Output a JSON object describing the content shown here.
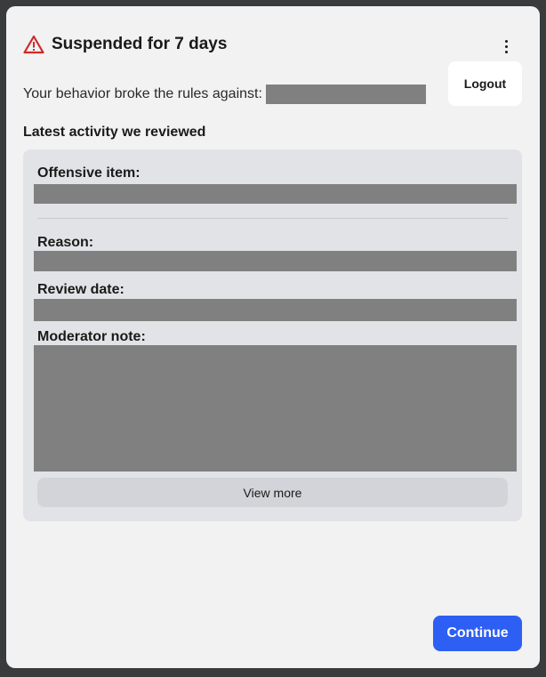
{
  "modal": {
    "title": "Suspended for 7 days",
    "rules_text": "Your behavior broke the rules against:",
    "logout_label": "Logout",
    "section_title": "Latest activity we reviewed",
    "fields": {
      "offensive_item_label": "Offensive item:",
      "reason_label": "Reason:",
      "review_date_label": "Review date:",
      "moderator_note_label": "Moderator note:"
    },
    "view_more_label": "View more",
    "continue_label": "Continue"
  },
  "colors": {
    "warning_icon": "#cc2b2b",
    "primary_button": "#2d5ff5",
    "redaction": "#808080"
  },
  "icons": {
    "warning": "warning-triangle-icon",
    "menu": "more-vertical-icon"
  }
}
